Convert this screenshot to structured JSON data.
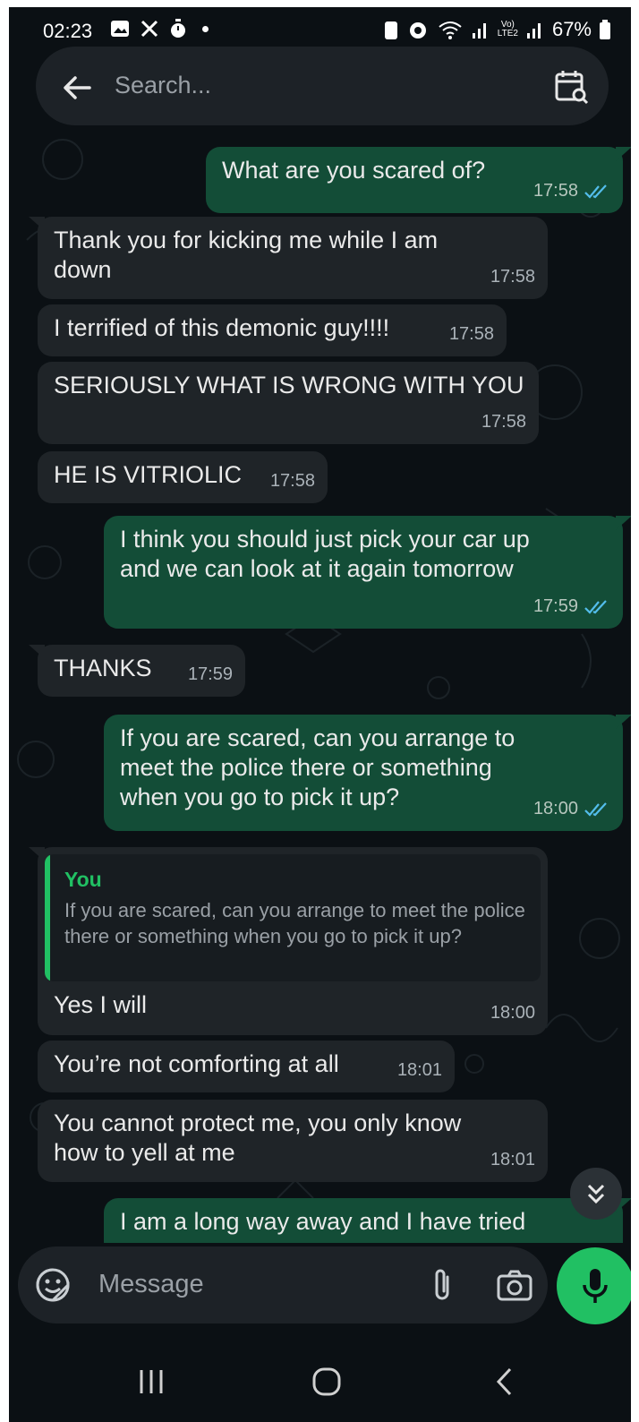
{
  "status_bar": {
    "time": "02:23",
    "battery": "67%"
  },
  "search": {
    "placeholder": "Search..."
  },
  "messages": [
    {
      "dir": "out",
      "text": "What are you scared of?",
      "time": "17:58"
    },
    {
      "dir": "in",
      "text": "Thank you for kicking me while I am\ndown",
      "time": "17:58"
    },
    {
      "dir": "in",
      "text": "I terrified of this demonic guy!!!!",
      "time": "17:58"
    },
    {
      "dir": "in",
      "text": "SERIOUSLY WHAT IS WRONG WITH YOU",
      "time": "17:58"
    },
    {
      "dir": "in",
      "text": "HE IS VITRIOLIC",
      "time": "17:58"
    },
    {
      "dir": "out",
      "text": "I think you should just pick your car up\nand we can look at it again tomorrow",
      "time": "17:59"
    },
    {
      "dir": "in",
      "text": "THANKS",
      "time": "17:59"
    },
    {
      "dir": "out",
      "text": "If you are scared, can you arrange to\nmeet the police there or something\nwhen you go to pick it up?",
      "time": "18:00"
    },
    {
      "dir": "in",
      "text": "Yes I will",
      "time": "18:00",
      "quote": {
        "author": "You",
        "text": "If you are scared, can you arrange to meet the police there or something when you go to pick it up?"
      }
    },
    {
      "dir": "in",
      "text": "You’re not comforting at all",
      "time": "18:01"
    },
    {
      "dir": "in",
      "text": "You cannot protect me, you only know\nhow to yell at me",
      "time": "18:01"
    },
    {
      "dir": "out",
      "text": "I am a long way away and I have tried",
      "time": ""
    }
  ],
  "composer": {
    "placeholder": "Message"
  },
  "colors": {
    "background": "#0b1014",
    "incoming_bubble": "#1f2428",
    "outgoing_bubble": "#134d37",
    "accent_green": "#21c063",
    "read_ticks": "#53bdeb"
  },
  "icons": [
    "back-arrow-icon",
    "calendar-search-icon",
    "emoji-sticker-icon",
    "attach-icon",
    "camera-icon",
    "mic-icon",
    "scroll-down-icon",
    "nav-recent-icon",
    "nav-home-icon",
    "nav-back-icon"
  ]
}
